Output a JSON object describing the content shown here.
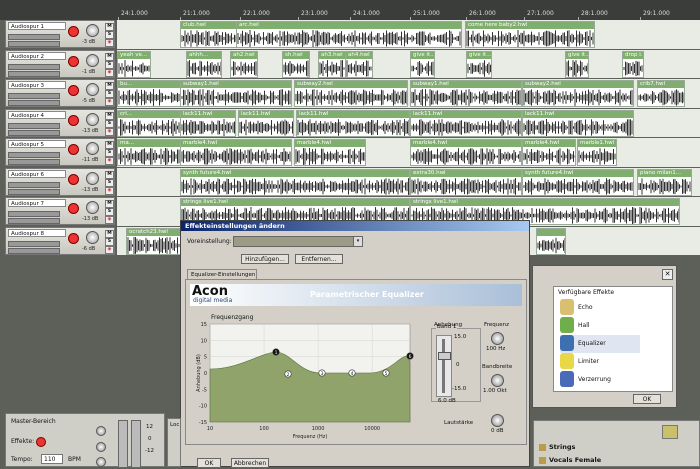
{
  "ruler": {
    "ticks": [
      "24:1.000",
      "21:1.000",
      "22:1.000",
      "23:1.000",
      "24:1.000",
      "25:1.000",
      "26:1.000",
      "27:1.000",
      "28:1.000",
      "29:1.000",
      "30:1.000",
      "31:1.000",
      "32:1.000"
    ]
  },
  "tracks": [
    {
      "name": "Audiospur 1",
      "db": "-3 dB",
      "clips": [
        {
          "label": "club.hwl"
        },
        {
          "label": "arc.hwl"
        },
        {
          "label": "come here baby2.hwl"
        }
      ]
    },
    {
      "name": "Audiospur 2",
      "db": "-1 dB",
      "clips": [
        {
          "label": "yeah ve..."
        },
        {
          "label": "ahhh..."
        },
        {
          "label": "ah2.hwl"
        },
        {
          "label": "sh.hwl"
        },
        {
          "label": "ah3.hwl"
        },
        {
          "label": "ah4.hwl"
        },
        {
          "label": "give it..."
        },
        {
          "label": "give it..."
        },
        {
          "label": "give it..."
        },
        {
          "label": "drop i..."
        }
      ]
    },
    {
      "name": "Audiospur 3",
      "db": "-5 dB",
      "clips": [
        {
          "label": "bu..."
        },
        {
          "label": "subway1.hwl"
        },
        {
          "label": "subway2.hwl"
        },
        {
          "label": "subway1.hwl"
        },
        {
          "label": "subway2.hwl"
        },
        {
          "label": "crib7.hwl"
        }
      ]
    },
    {
      "name": "Audiospur 4",
      "db": "-13 dB",
      "clips": [
        {
          "label": "cri..."
        },
        {
          "label": "lack11.hwl"
        },
        {
          "label": "lack11.hwl"
        },
        {
          "label": "lack11.hwl"
        },
        {
          "label": "lack11.hwl"
        },
        {
          "label": "lack11.hwl"
        }
      ]
    },
    {
      "name": "Audiospur 5",
      "db": "-11 dB",
      "clips": [
        {
          "label": "ma..."
        },
        {
          "label": "marble4.hwl"
        },
        {
          "label": "marble4.hwl"
        },
        {
          "label": "marble4.hwl"
        },
        {
          "label": "marble4.hwl"
        },
        {
          "label": "marble1.hwl"
        }
      ]
    },
    {
      "name": "Audiospur 6",
      "db": "-13 dB",
      "clips": [
        {
          "label": "synth future4.hwl"
        },
        {
          "label": "extra30.hwl"
        },
        {
          "label": "synth future4.hwl"
        },
        {
          "label": "piano milan1..."
        }
      ]
    },
    {
      "name": "Audiospur 7",
      "db": "-13 dB",
      "clips": [
        {
          "label": "strings live1.hwl"
        },
        {
          "label": "strings live1.hwl"
        }
      ]
    },
    {
      "name": "Audiospur 8",
      "db": "-6 dB",
      "clips": [
        {
          "label": "ocratch23.hwl"
        },
        {
          "label": ""
        }
      ]
    }
  ],
  "track_buttons": {
    "mute": "M",
    "solo": "S"
  },
  "dialog": {
    "title": "Effekteinstellungen ändern",
    "preset_label": "Voreinstellung:",
    "add_button": "Hinzufügen...",
    "remove_button": "Entfernen...",
    "tab": "Equalizer-Einstellungen",
    "brand_top": "Acon",
    "brand_bottom": "digital media",
    "eq_title": "Parametrischer Equalizer",
    "response_label": "Frequenzgang",
    "y_axis_label": "Anhebung (dB)",
    "x_axis_label": "Frequenz (Hz)",
    "y_ticks": [
      "15",
      "10",
      "5",
      "0",
      "-5",
      "-10",
      "-15"
    ],
    "x_ticks": [
      "10",
      "100",
      "1000",
      "10000"
    ],
    "points": [
      "1",
      "2",
      "3",
      "4",
      "5",
      "6"
    ],
    "band_label": "Band 1",
    "gain_label": "Anhebung",
    "gain_scale": [
      "15.0",
      "0",
      "-15.0"
    ],
    "gain_value": "6.0 dB",
    "freq_label": "Frequenz",
    "freq_value": "100 Hz",
    "bw_label": "Bandbreite",
    "bw_value": "1.00 Okt",
    "volume_label": "Lautstärke",
    "volume_value": "0 dB",
    "ok_button": "OK",
    "cancel_button": "Abbrechen"
  },
  "effects_panel": {
    "title": "Verfügbare Effekte",
    "items": [
      {
        "label": "Echo",
        "color": "#d8c070"
      },
      {
        "label": "Hall",
        "color": "#6fae4a"
      },
      {
        "label": "Equalizer",
        "color": "#3e6fb0"
      },
      {
        "label": "Limiter",
        "color": "#e8d848"
      },
      {
        "label": "Verzerrung",
        "color": "#4a6cb8"
      }
    ],
    "ok_button": "OK"
  },
  "master": {
    "title": "Master-Bereich",
    "effects_label": "Effekte:",
    "tempo_label": "Tempo:",
    "tempo_value": "110",
    "tempo_unit": "BPM",
    "scale": [
      "12",
      "0",
      "-12"
    ]
  },
  "browser": {
    "partial_label": "Loc",
    "items": [
      "Strings",
      "Vocals Female"
    ]
  },
  "colors": {
    "clip_header": "#7fae6e",
    "lane_bg": "#e8ece4",
    "eq_fill": "#8fa36a",
    "dialog_title": "#0a246a"
  }
}
